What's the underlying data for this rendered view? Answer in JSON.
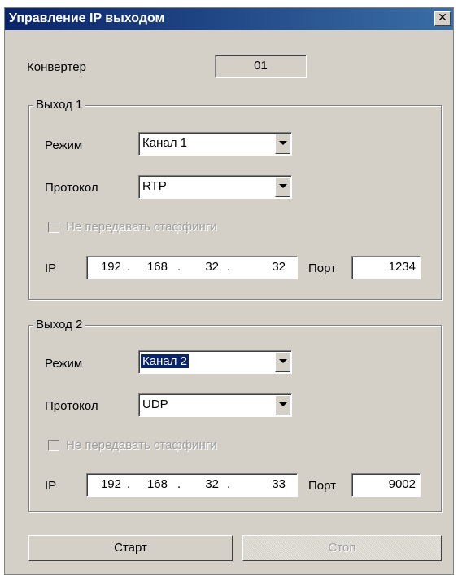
{
  "window": {
    "title": "Управление IP выходом"
  },
  "converter": {
    "label": "Конвертер",
    "value": "01"
  },
  "outputs": [
    {
      "legend": "Выход 1",
      "mode_label": "Режим",
      "mode_value": "Канал 1",
      "protocol_label": "Протокол",
      "protocol_value": "RTP",
      "stuffing_label": "Не передавать стаффинги",
      "ip_label": "IP",
      "ip": [
        "192",
        "168",
        "32",
        "32"
      ],
      "port_label": "Порт",
      "port_value": "1234"
    },
    {
      "legend": "Выход 2",
      "mode_label": "Режим",
      "mode_value": "Канал 2",
      "protocol_label": "Протокол",
      "protocol_value": "UDP",
      "stuffing_label": "Не передавать стаффинги",
      "ip_label": "IP",
      "ip": [
        "192",
        "168",
        "32",
        "33"
      ],
      "port_label": "Порт",
      "port_value": "9002"
    }
  ],
  "buttons": {
    "start": "Старт",
    "stop": "Стоп"
  }
}
